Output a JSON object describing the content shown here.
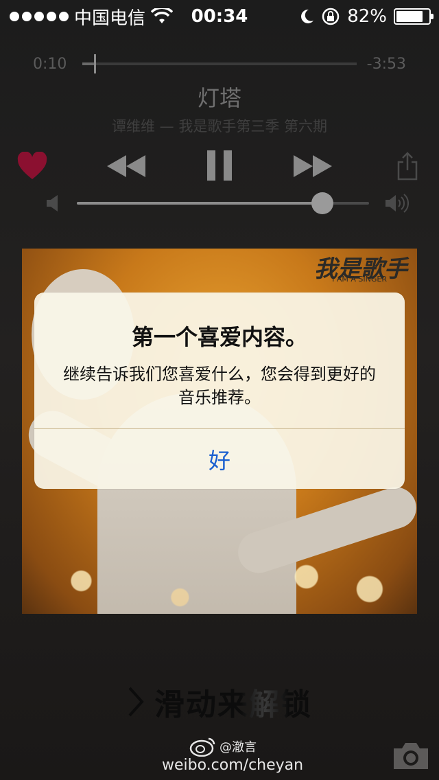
{
  "status_bar": {
    "carrier": "中国电信",
    "time": "00:34",
    "battery": "82%",
    "battery_level": 0.82
  },
  "player": {
    "elapsed": "0:10",
    "remaining": "-3:53",
    "progress": 0.043,
    "title": "灯塔",
    "subtitle": "谭维维 — 我是歌手第三季 第六期",
    "volume": 0.84,
    "liked": true,
    "colors": {
      "heart": "#8b1030"
    }
  },
  "album_art": {
    "logo": "我是歌手",
    "logo_sub": "I AM A SINGER"
  },
  "alert": {
    "title": "第一个喜爱内容。",
    "message": "继续告诉我们您喜爱什么，您会得到更好的音乐推荐。",
    "button_label": "好"
  },
  "lock_screen": {
    "unlock_label": "滑动来解锁"
  },
  "watermark": {
    "handle": "@澈言",
    "url": "weibo.com/cheyan"
  },
  "icons": [
    "signal-dots-icon",
    "wifi-icon",
    "moon-icon",
    "rotation-lock-icon",
    "battery-icon",
    "heart-icon",
    "rewind-icon",
    "pause-icon",
    "fast-forward-icon",
    "share-icon",
    "volume-low-icon",
    "volume-high-icon",
    "chevron-right-icon",
    "weibo-icon",
    "camera-icon"
  ]
}
